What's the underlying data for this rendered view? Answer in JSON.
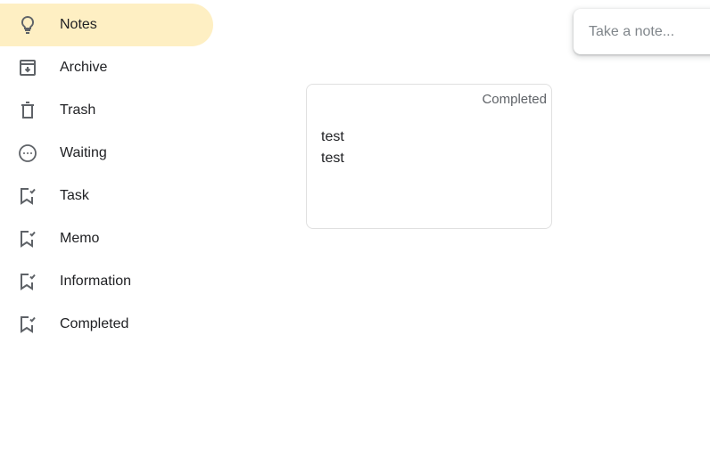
{
  "sidebar": {
    "items": [
      {
        "label": "Notes",
        "icon": "lightbulb-icon",
        "active": true
      },
      {
        "label": "Archive",
        "icon": "archive-icon",
        "active": false
      },
      {
        "label": "Trash",
        "icon": "trash-icon",
        "active": false
      },
      {
        "label": "Waiting",
        "icon": "more-horizontal-circle-icon",
        "active": false
      },
      {
        "label": "Task",
        "icon": "label-check-icon",
        "active": false
      },
      {
        "label": "Memo",
        "icon": "label-check-icon",
        "active": false
      },
      {
        "label": "Information",
        "icon": "label-check-icon",
        "active": false
      },
      {
        "label": "Completed",
        "icon": "label-check-icon",
        "active": false
      }
    ]
  },
  "take_note": {
    "placeholder": "Take a note..."
  },
  "notes": [
    {
      "label": "Completed",
      "lines": [
        "test",
        "test"
      ]
    }
  ],
  "colors": {
    "active_nav_background": "#feefc3",
    "text": "#202124",
    "icon": "#5f6368",
    "placeholder": "#80868b",
    "card_border": "#e0e0e0"
  }
}
